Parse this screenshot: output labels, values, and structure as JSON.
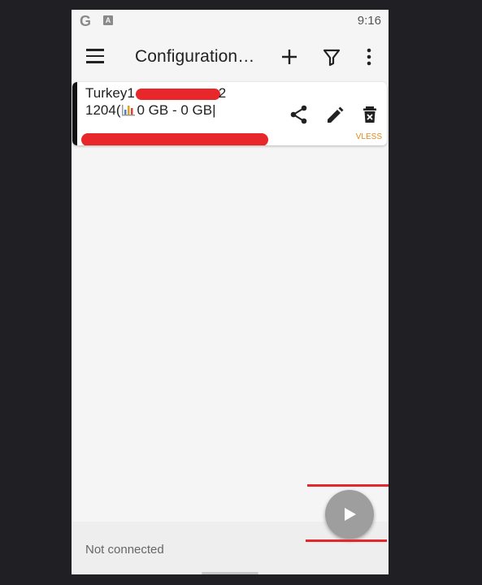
{
  "status_bar": {
    "g_glyph": "G",
    "a_glyph": "A",
    "time": "9:16"
  },
  "app_bar": {
    "title": "Configuration…",
    "icons": [
      "menu-icon",
      "add-icon",
      "filter-icon",
      "more-vert-icon"
    ]
  },
  "server": {
    "name_prefix": "Turkey1",
    "name_suffix": "2",
    "line2_prefix": "1204(",
    "traffic": "0 GB - 0 GB",
    "line2_suffix": "|",
    "type": "VLESS",
    "actions": [
      "share-icon",
      "edit-icon",
      "delete-icon"
    ]
  },
  "bottom": {
    "status": "Not connected"
  },
  "colors": {
    "redaction": "#e8272a",
    "type_label": "#e08a1c",
    "fab": "#9e9e9e"
  }
}
